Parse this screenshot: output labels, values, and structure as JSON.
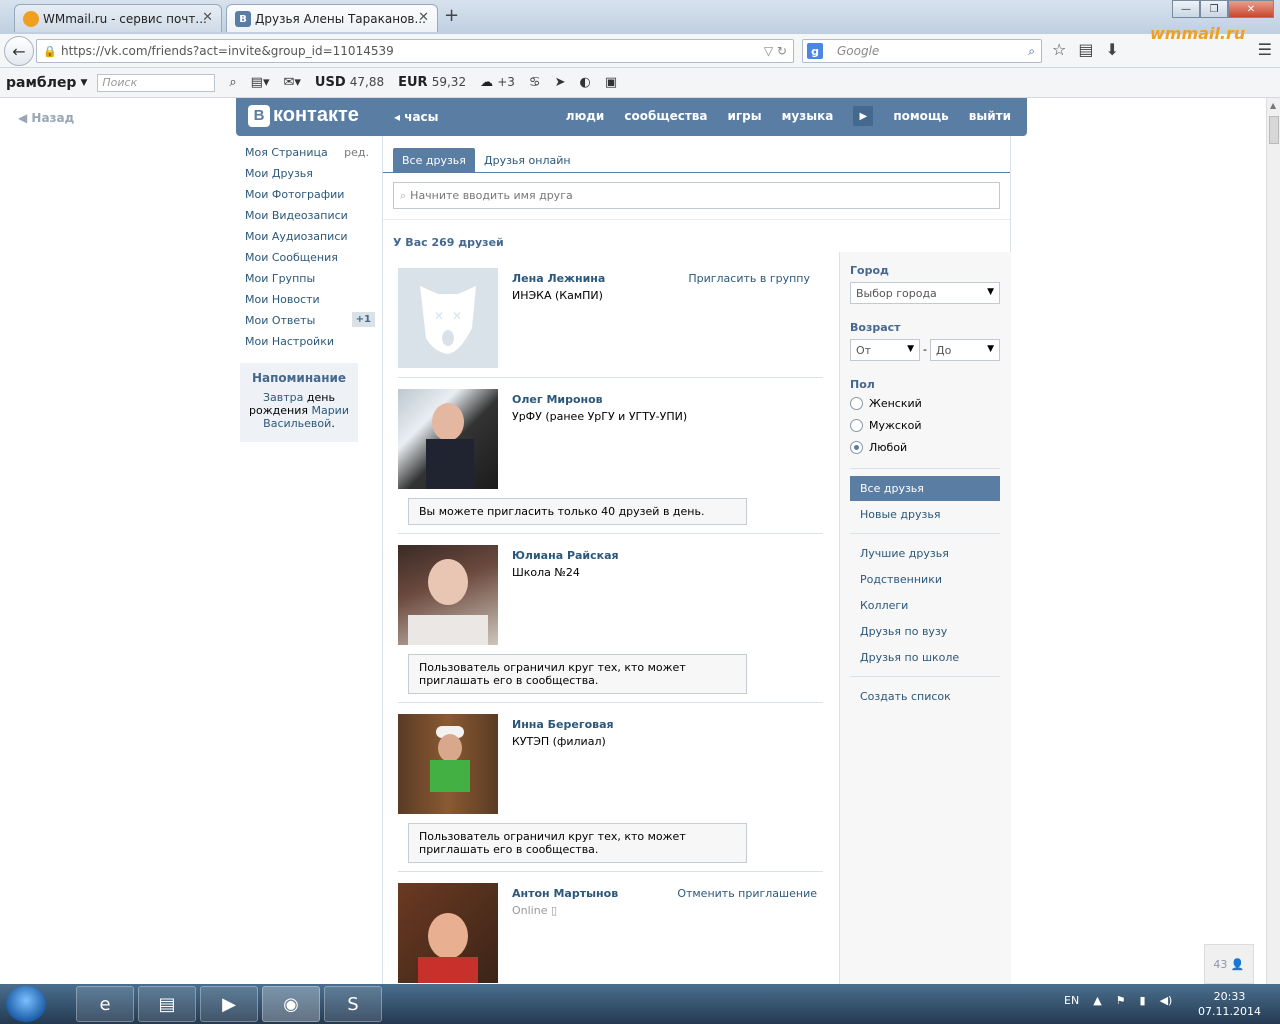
{
  "browser": {
    "tabs": [
      {
        "title": "WMmail.ru - сервис почт...",
        "active": false
      },
      {
        "title": "Друзья Алены Тараканов...",
        "active": true
      }
    ],
    "url": "https://vk.com/friends?act=invite&group_id=11014539",
    "search_placeholder": "Google",
    "logo_text": "wmmail.ru"
  },
  "rambler": {
    "logo": "рамблер",
    "search_placeholder": "Поиск",
    "usd_label": "USD",
    "usd_value": "47,88",
    "eur_label": "EUR",
    "eur_value": "59,32",
    "weather": "+3"
  },
  "page": {
    "back": "Назад"
  },
  "vk": {
    "logo": "контакте",
    "clock": "часы",
    "nav": [
      "люди",
      "сообщества",
      "игры",
      "музыка",
      "помощь",
      "выйти"
    ]
  },
  "menu": {
    "items": [
      "Моя Страница",
      "Мои Друзья",
      "Мои Фотографии",
      "Мои Видеозаписи",
      "Мои Аудиозаписи",
      "Мои Сообщения",
      "Мои Группы",
      "Мои Новости",
      "Мои Ответы",
      "Мои Настройки"
    ],
    "edit": "ред.",
    "answers_badge": "+1"
  },
  "reminder": {
    "title": "Напоминание",
    "w1": "Завтра",
    "w2": "день",
    "w3": "рождения",
    "w4": "Марии",
    "w5": "Васильевой",
    "w6": "."
  },
  "friends": {
    "tab_all": "Все друзья",
    "tab_online": "Друзья онлайн",
    "search_placeholder": "Начните вводить имя друга",
    "count": "У Вас 269 друзей",
    "list": [
      {
        "name": "Лена Лежнина",
        "sub": "ИНЭКА (КамПИ)",
        "action": "Пригласить в группу",
        "note": ""
      },
      {
        "name": "Олег Миронов",
        "sub": "УрФУ (ранее УрГУ и УГТУ-УПИ)",
        "action": "",
        "note": "Вы можете пригласить только 40 друзей в день."
      },
      {
        "name": "Юлиана Райская",
        "sub": "Школа №24",
        "action": "",
        "note": "Пользователь ограничил круг тех, кто может приглашать его в сообщества."
      },
      {
        "name": "Инна Береговая",
        "sub": "КУТЭП (филиал)",
        "action": "",
        "note": "Пользователь ограничил круг тех, кто может приглашать его в сообщества."
      },
      {
        "name": "Антон Мартынов",
        "sub": "Online",
        "action": "Отменить приглашение",
        "note": ""
      }
    ]
  },
  "filters": {
    "city_label": "Город",
    "city_value": "Выбор города",
    "age_label": "Возраст",
    "age_from": "От",
    "age_to": "До",
    "age_dash": "-",
    "sex_label": "Пол",
    "sex_options": [
      "Женский",
      "Мужской",
      "Любой"
    ],
    "sex_selected": "Любой",
    "links_1": [
      "Все друзья",
      "Новые друзья"
    ],
    "links_2": [
      "Лучшие друзья",
      "Родственники",
      "Коллеги",
      "Друзья по вузу",
      "Друзья по школе"
    ],
    "links_3": [
      "Создать список"
    ]
  },
  "chat_count": "43",
  "taskbar": {
    "lang": "EN",
    "time": "20:33",
    "date": "07.11.2014"
  }
}
